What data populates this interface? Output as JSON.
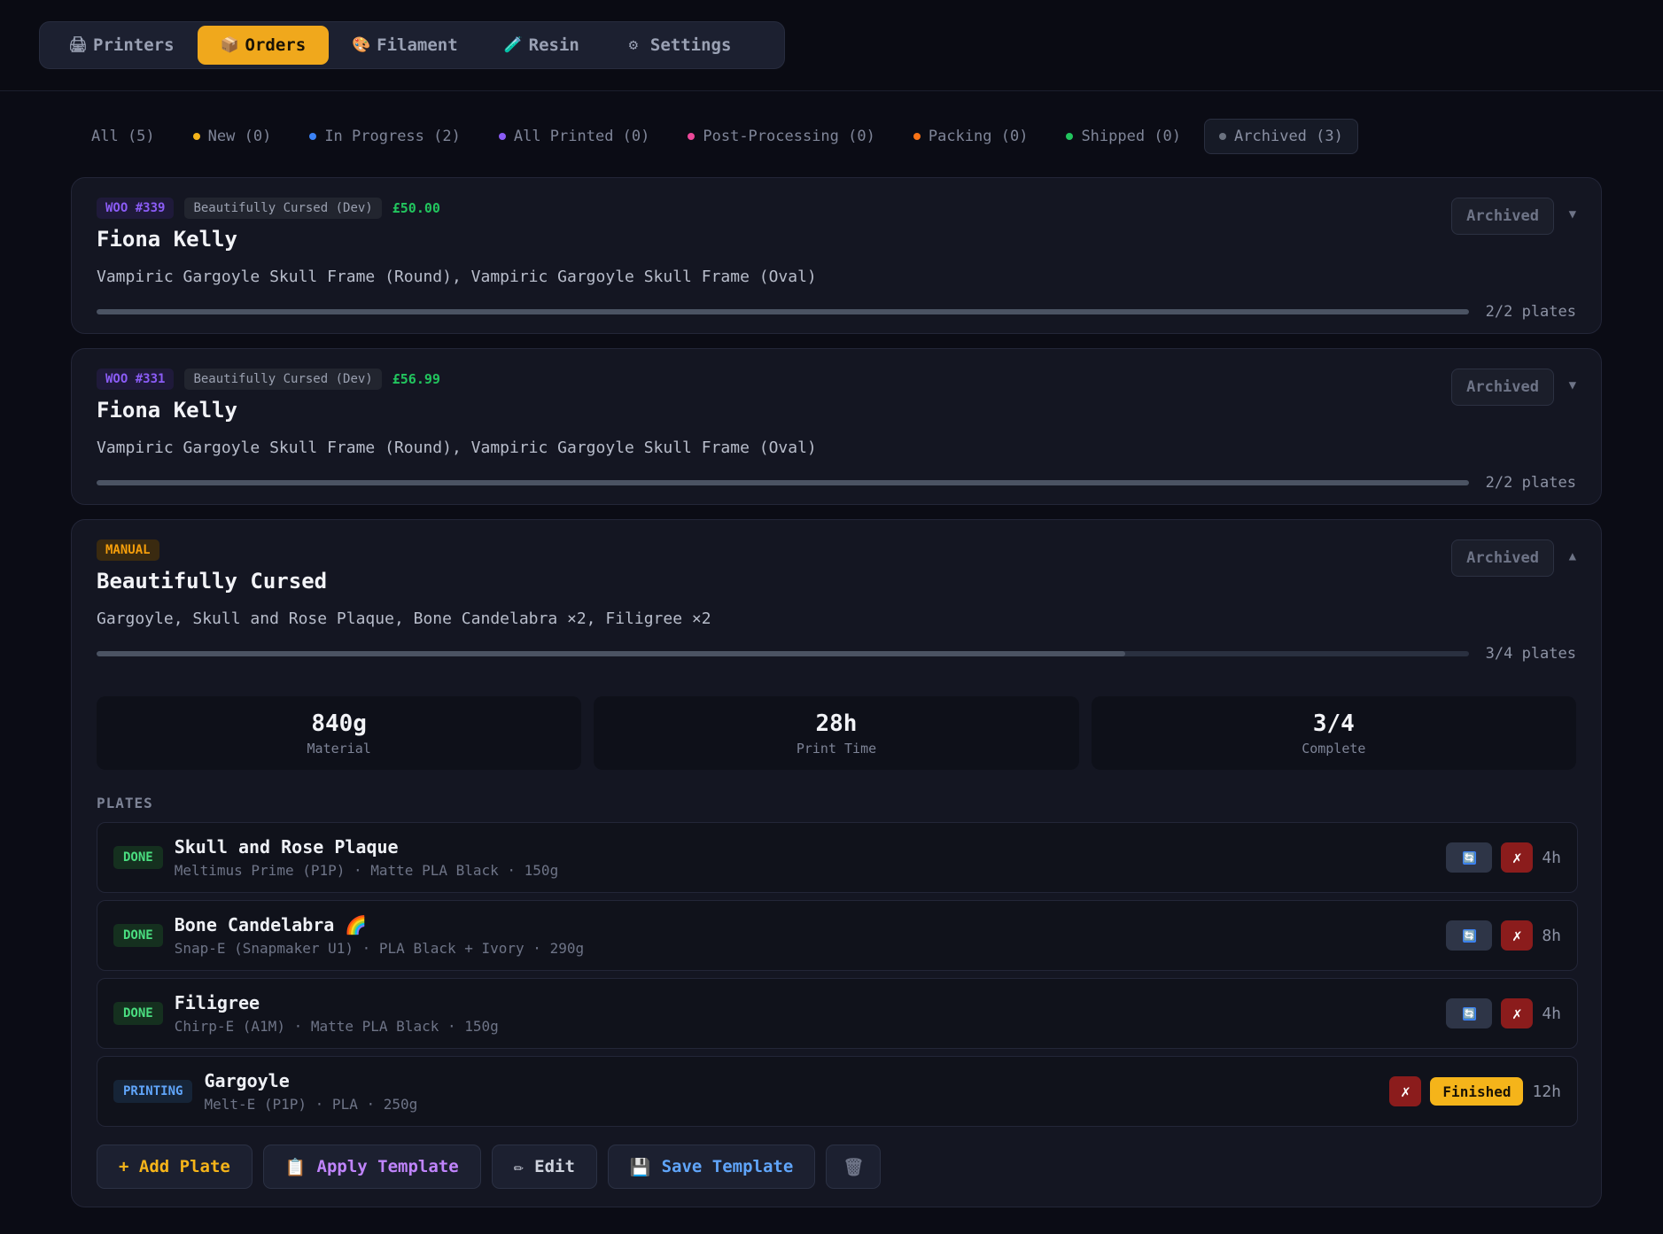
{
  "nav": {
    "tabs": [
      {
        "label": "Printers",
        "icon": "printer-icon",
        "glyph": "🖨"
      },
      {
        "label": "Orders",
        "icon": "package-icon",
        "glyph": "📦",
        "active": true
      },
      {
        "label": "Filament",
        "icon": "palette-icon",
        "glyph": "🎨"
      },
      {
        "label": "Resin",
        "icon": "brush-icon",
        "glyph": "🧪"
      },
      {
        "label": "Settings",
        "icon": "gear-icon",
        "glyph": "⚙"
      }
    ]
  },
  "filters": [
    {
      "label": "All (5)",
      "color": ""
    },
    {
      "label": "New (0)",
      "color": "#f5b41a"
    },
    {
      "label": "In Progress (2)",
      "color": "#3b82f6"
    },
    {
      "label": "All Printed (0)",
      "color": "#8b5cf6"
    },
    {
      "label": "Post-Processing (0)",
      "color": "#ec4899"
    },
    {
      "label": "Packing (0)",
      "color": "#f97316"
    },
    {
      "label": "Shipped (0)",
      "color": "#22c55e"
    },
    {
      "label": "Archived (3)",
      "color": "#6b7280",
      "active": true
    }
  ],
  "orders": [
    {
      "source_tag": "WOO #339",
      "shop": "Beautifully Cursed (Dev)",
      "price": "£50.00",
      "customer": "Fiona Kelly",
      "items": "Vampiric Gargoyle Skull Frame (Round), Vampiric Gargoyle Skull Frame (Oval)",
      "progress": 1.0,
      "progress_label": "2/2 plates",
      "status": "Archived",
      "chevron": "▼"
    },
    {
      "source_tag": "WOO #331",
      "shop": "Beautifully Cursed (Dev)",
      "price": "£56.99",
      "customer": "Fiona Kelly",
      "items": "Vampiric Gargoyle Skull Frame (Round), Vampiric Gargoyle Skull Frame (Oval)",
      "progress": 1.0,
      "progress_label": "2/2 plates",
      "status": "Archived",
      "chevron": "▼"
    },
    {
      "source_tag": "MANUAL",
      "customer": "Beautifully Cursed",
      "items": "Gargoyle, Skull and Rose Plaque, Bone Candelabra ×2, Filigree ×2",
      "progress": 0.75,
      "progress_label": "3/4 plates",
      "status": "Archived",
      "chevron": "▲",
      "stats": [
        {
          "value": "840g",
          "label": "Material"
        },
        {
          "value": "28h",
          "label": "Print Time"
        },
        {
          "value": "3/4",
          "label": "Complete"
        }
      ],
      "plates_heading": "PLATES",
      "plates": [
        {
          "status": "DONE",
          "name": "Skull and Rose Plaque",
          "meta": "Meltimus Prime (P1P) · Matte PLA Black · 150g",
          "duration": "4h"
        },
        {
          "status": "DONE",
          "name": "Bone Candelabra 🌈",
          "meta": "Snap-E (Snapmaker U1) · PLA Black + Ivory · 290g",
          "duration": "8h"
        },
        {
          "status": "DONE",
          "name": "Filigree",
          "meta": "Chirp-E (A1M) · Matte PLA Black · 150g",
          "duration": "4h"
        },
        {
          "status": "PRINTING",
          "name": "Gargoyle",
          "meta": "Melt-E (P1P) · PLA · 250g",
          "duration": "12h",
          "finished_label": "Finished"
        }
      ],
      "reprint_glyph": "🔄",
      "cancel_glyph": "✗",
      "actions": {
        "add_plate": "+ Add Plate",
        "apply_template": "Apply Template",
        "apply_glyph": "📋",
        "edit": "Edit",
        "edit_glyph": "✏",
        "save_template": "Save Template",
        "save_glyph": "💾",
        "delete_glyph": "🗑"
      }
    }
  ]
}
